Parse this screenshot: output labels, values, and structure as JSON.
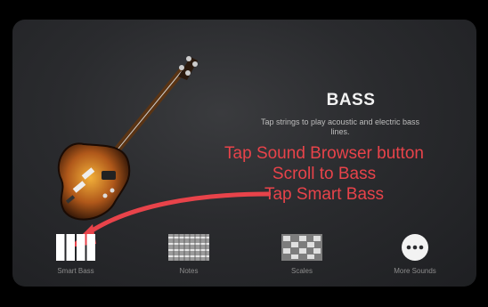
{
  "instrument": {
    "title": "BASS",
    "subtitle": "Tap strings to play acoustic and electric bass lines."
  },
  "annotations": [
    "Tap Sound Browser button",
    "Scroll to Bass",
    "Tap Smart Bass"
  ],
  "tiles": [
    {
      "label": "Smart Bass",
      "icon": "smart-bass-icon"
    },
    {
      "label": "Notes",
      "icon": "notes-grid-icon"
    },
    {
      "label": "Scales",
      "icon": "scales-grid-icon"
    },
    {
      "label": "More Sounds",
      "icon": "more-dots-icon"
    }
  ],
  "colors": {
    "annotation": "#e8434a",
    "background": "#2a2b2e"
  }
}
